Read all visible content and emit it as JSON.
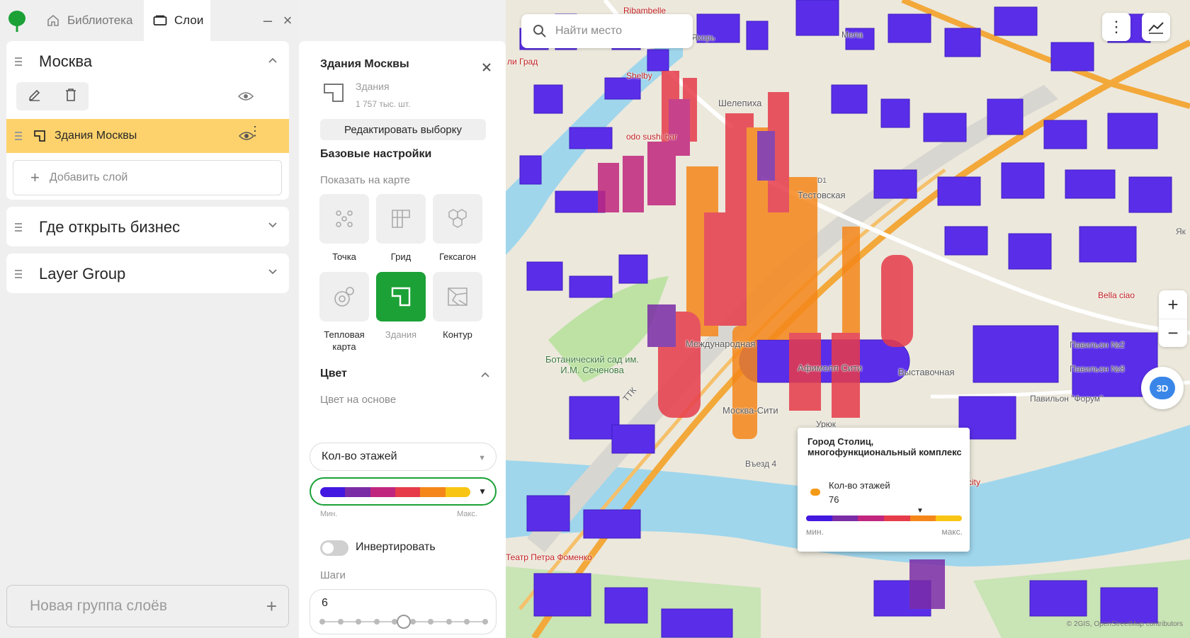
{
  "tabs": {
    "library": "Библиотека",
    "layers": "Слои"
  },
  "window": {
    "minimize": "–",
    "close": "×"
  },
  "groups": [
    {
      "title": "Москва",
      "expanded": true
    },
    {
      "title": "Где открыть бизнес",
      "expanded": false
    },
    {
      "title": "Layer Group",
      "expanded": false
    }
  ],
  "layer": {
    "name": "Здания Москвы"
  },
  "add_layer": "Добавить слой",
  "new_group": "Новая группа слоёв",
  "settings": {
    "title": "Здания Москвы",
    "type": "Здания",
    "count": "1 757 тыс. шт.",
    "edit_button": "Редактировать выборку",
    "base_section": "Базовые настройки",
    "show_on_map": "Показать на карте",
    "viz": [
      "Точка",
      "Грид",
      "Гексагон",
      "Тепловая карта",
      "Здания",
      "Контур"
    ],
    "color_section": "Цвет",
    "color_based_on": "Цвет на основе",
    "color_field": "Кол-во этажей",
    "min_label": "Мин.",
    "max_label": "Макс.",
    "invert": "Инвертировать",
    "steps_label": "Шаги",
    "steps_value": "6",
    "steps_fraction": 0.5
  },
  "palette": [
    "#4318e0",
    "#7a2ba6",
    "#c0267e",
    "#e63c4a",
    "#f5871a",
    "#f8c514"
  ],
  "map": {
    "search_placeholder": "Найти место",
    "labels": {
      "ribambelle": "Ribambelle",
      "yakor": "Якорь",
      "mela": "Мела",
      "shelby": "Shelby",
      "shelepikha": "Шелепиха",
      "grad": "ли Град",
      "odo": "odo sushi bar",
      "testovskaya": "Тестовская",
      "d1": "D1",
      "mezhdunarodnaya": "Международная",
      "afimall": "Афимолл Сити",
      "vystavochnaya": "Выставочная",
      "moscow_city": "Москва-Сити",
      "botanic": "Ботанический сад им.\nИ.М. Сеченова",
      "ttk": "ТТК",
      "entry4": "Въезд 4",
      "urok": "Урюк",
      "bella": "Bella ciao",
      "pav2": "Павильон №2",
      "pav8": "Павильон №8",
      "forum": "Павильон \"Форум\"",
      "fomenko": "Театр Петра Фоменко",
      "city": "city",
      "ya": "Як"
    },
    "zoom_in": "+",
    "zoom_out": "−",
    "btn_3d": "3D",
    "copyright": "© 2GIS, OpenStreetMap contributors",
    "popup": {
      "title": "Город Столиц, многофункциональный комплекс",
      "property": "Кол-во этажей",
      "value": "76",
      "min": "мин.",
      "max": "макс."
    }
  }
}
